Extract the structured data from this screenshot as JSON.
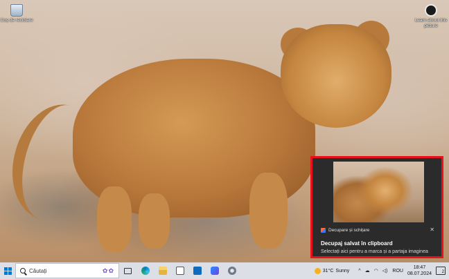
{
  "desktop": {
    "icons": [
      {
        "label": "Coș de reciclare",
        "icon": "recycle-bin-icon"
      },
      {
        "label": "Learn about this picture",
        "icon": "learn-about-picture-icon"
      }
    ]
  },
  "toast": {
    "app_name": "Decupare și schițare",
    "title": "Decupaj salvat în clipboard",
    "body": "Selectați aici pentru a marca și a partaja imaginea",
    "close_glyph": "✕"
  },
  "taskbar": {
    "search_placeholder": "Căutați",
    "apps": [
      "task-view",
      "microsoft-edge",
      "file-explorer",
      "microsoft-store",
      "mail",
      "photos",
      "snipping-tool"
    ]
  },
  "tray": {
    "weather_temp": "31°C",
    "weather_text": "Sunny",
    "language": "ROU",
    "time": "18:47",
    "date": "08.07.2024",
    "notification_count": "2"
  }
}
